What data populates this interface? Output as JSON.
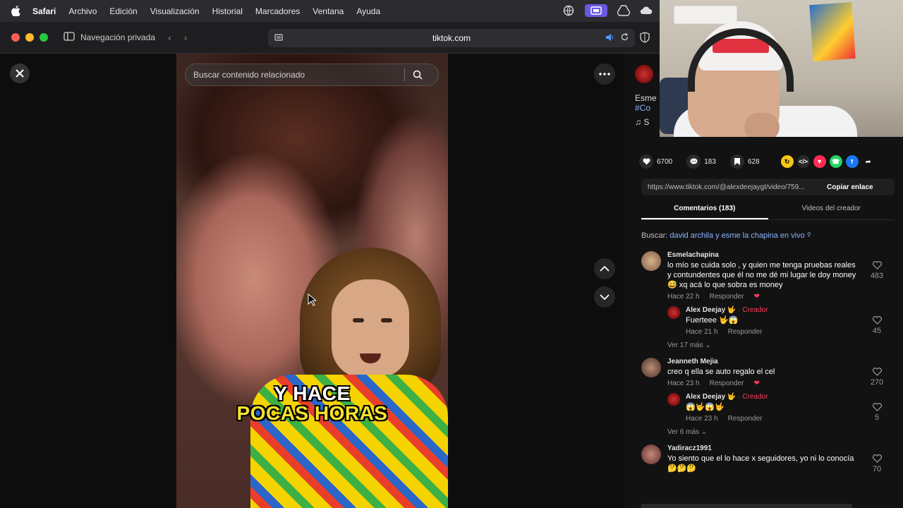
{
  "menubar": {
    "app": "Safari",
    "items": [
      "Archivo",
      "Edición",
      "Visualización",
      "Historial",
      "Marcadores",
      "Ventana",
      "Ayuda"
    ]
  },
  "toolbar": {
    "private_label": "Navegación privada",
    "url": "tiktok.com"
  },
  "video": {
    "search_placeholder": "Buscar contenido relacionado",
    "caption_line1": "Y HACE",
    "caption_line2": "POCAS HORAS"
  },
  "panel": {
    "desc_fragment": "Esme",
    "hashtag_fragment": "#Co",
    "music_fragment": "S",
    "likes": "6700",
    "comments_count": "183",
    "saves": "628",
    "link_url": "https://www.tiktok.com/@alexdeejaygt/video/759...",
    "copy_label": "Copiar enlace",
    "tab_comments": "Comentarios (183)",
    "tab_videos": "Videos del creador",
    "search_prefix": "Buscar:",
    "search_query": "david archila y esme la chapina en vivo"
  },
  "comments": [
    {
      "user": "Esmelachapina",
      "text": "lo mío se cuida solo , y quien me tenga pruebas reales y contundentes que él no me dé mi lugar le doy money 😅 xq acá lo que sobra es money",
      "time": "Hace 22 h",
      "reply_label": "Responder",
      "likes": "483",
      "replies": [
        {
          "user": "Alex Deejay 🤟",
          "tag": "· Creador",
          "text": "Fuerteee 🤟😱",
          "time": "Hace 21 h",
          "reply_label": "Responder",
          "likes": "45"
        }
      ],
      "more": "Ver 17 más"
    },
    {
      "user": "Jeanneth Mejia",
      "text": "creo q ella se auto regalo el cel",
      "time": "Hace 23 h",
      "reply_label": "Responder",
      "likes": "270",
      "replies": [
        {
          "user": "Alex Deejay 🤟",
          "tag": "· Creador",
          "text": "😱🤟😱🤟",
          "time": "Hace 23 h",
          "reply_label": "Responder",
          "likes": "5"
        }
      ],
      "more": "Ver 6 más"
    },
    {
      "user": "Yadiracz1991",
      "text": "Yo siento que el lo hace x seguidores, yo ni lo conocía 🤔🤔🤔",
      "time": "",
      "reply_label": "",
      "likes": "70",
      "replies": [],
      "more": ""
    }
  ],
  "colors": {
    "accent_red": "#ff3b5c",
    "link_blue": "#8ab4ff",
    "caption_yellow": "#f6e32a"
  }
}
